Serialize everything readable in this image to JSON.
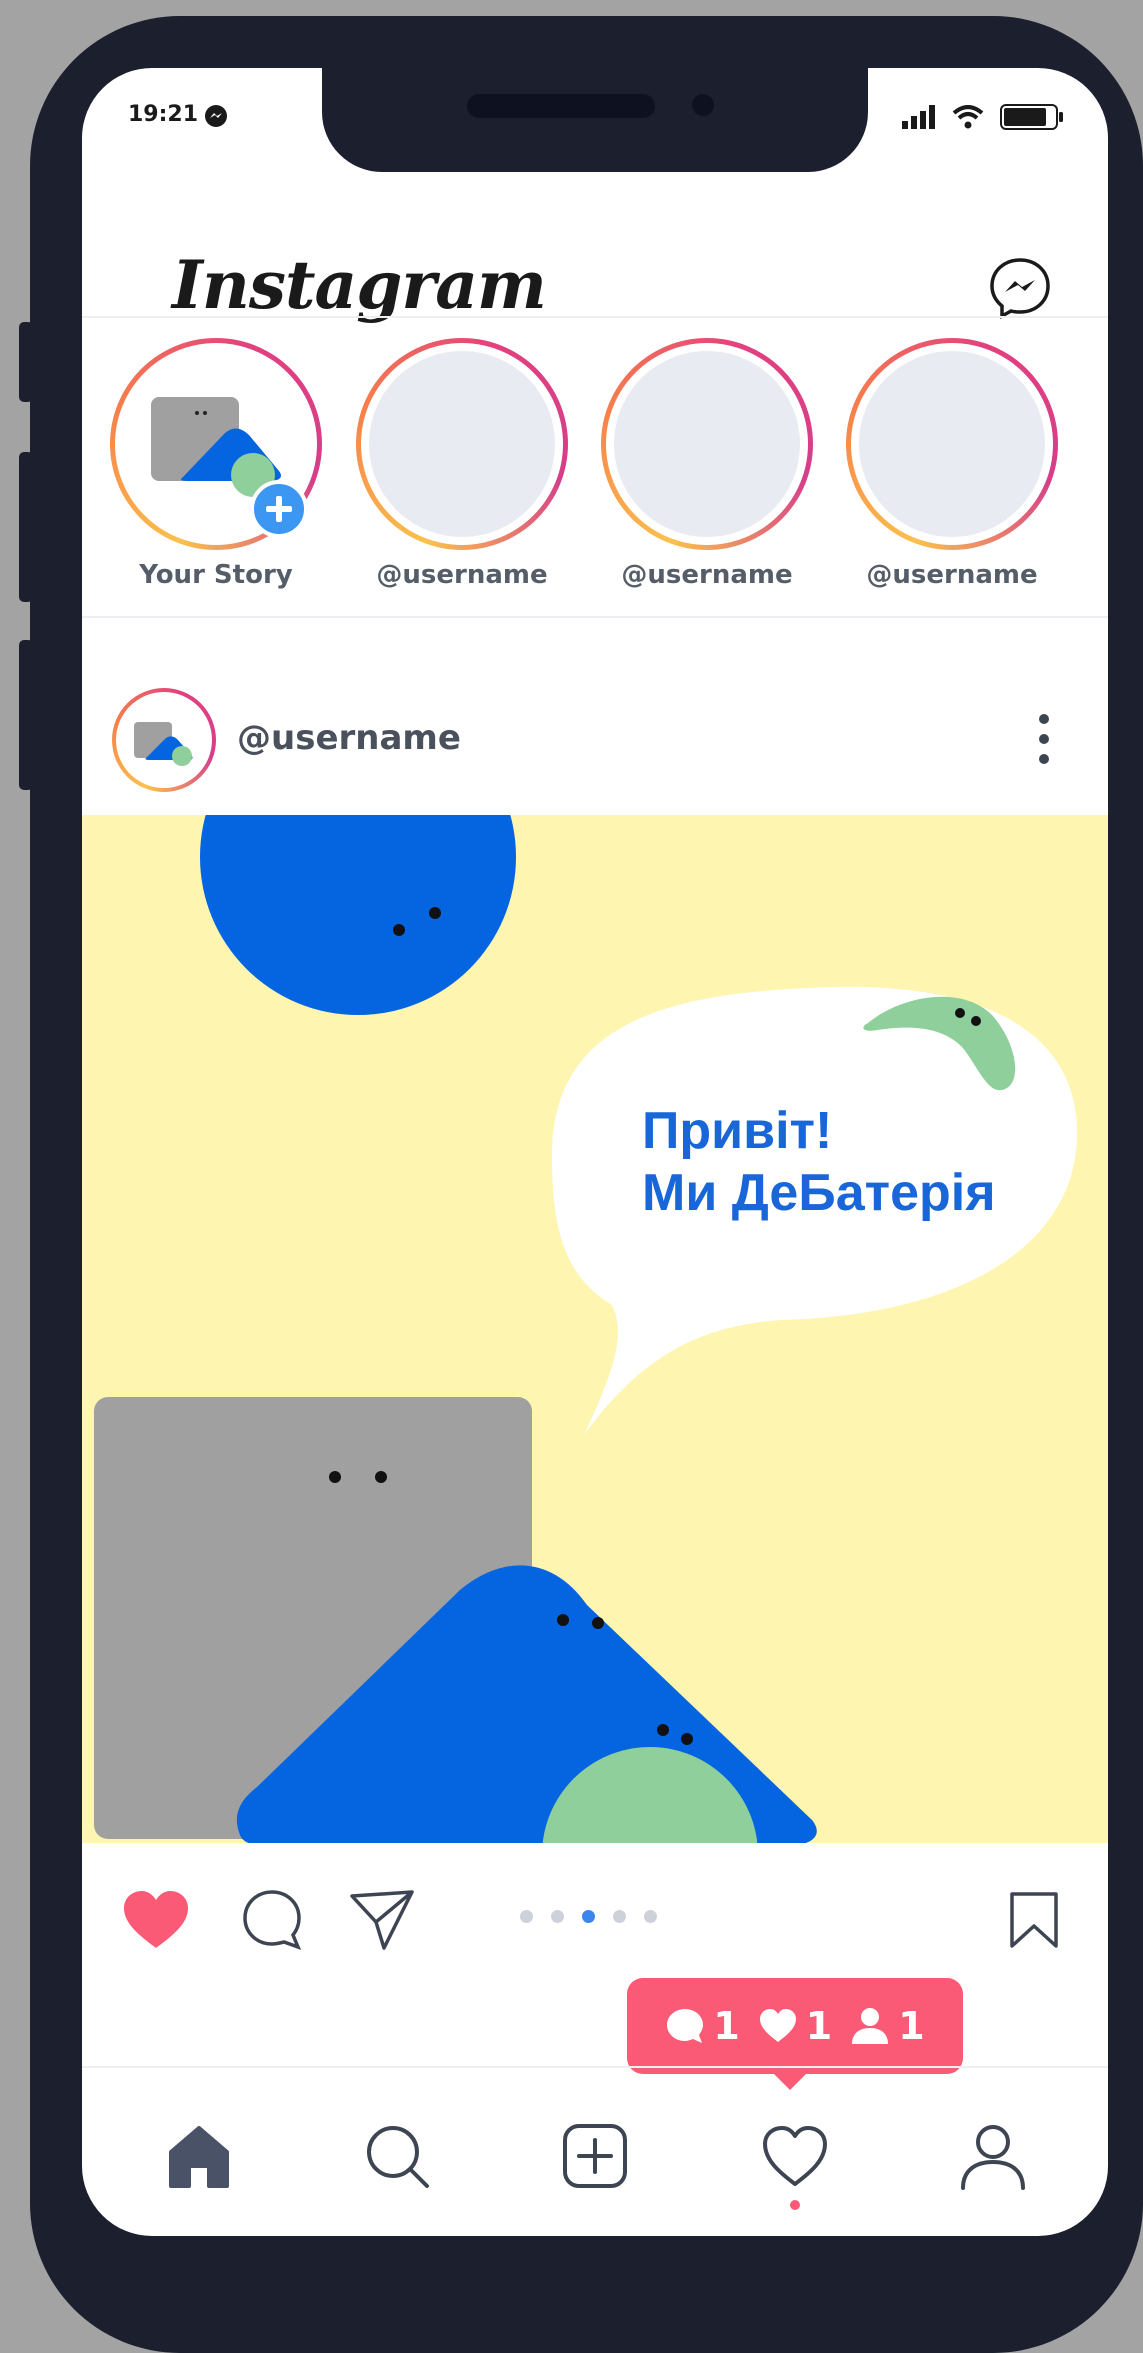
{
  "status_bar": {
    "time": "19:21"
  },
  "header": {
    "logo": "Instagram"
  },
  "stories": [
    {
      "label": "Your Story",
      "own": true
    },
    {
      "label": "@username"
    },
    {
      "label": "@username"
    },
    {
      "label": "@username"
    }
  ],
  "post": {
    "username": "@username",
    "image_text_line1": "Привіт!",
    "image_text_line2": "Ми ДеБатерія",
    "carousel": {
      "count": 5,
      "active_index": 2
    },
    "liked": true
  },
  "notification": {
    "comments": "1",
    "likes": "1",
    "followers": "1"
  },
  "tabs": [
    "home-tab",
    "search-tab",
    "create-tab",
    "activity-tab",
    "profile-tab"
  ],
  "colors": {
    "accent": "#fb5a76",
    "brand_blue": "#1866d8",
    "story_ring": "#e2407e",
    "image_bg": "#fef5b0"
  }
}
